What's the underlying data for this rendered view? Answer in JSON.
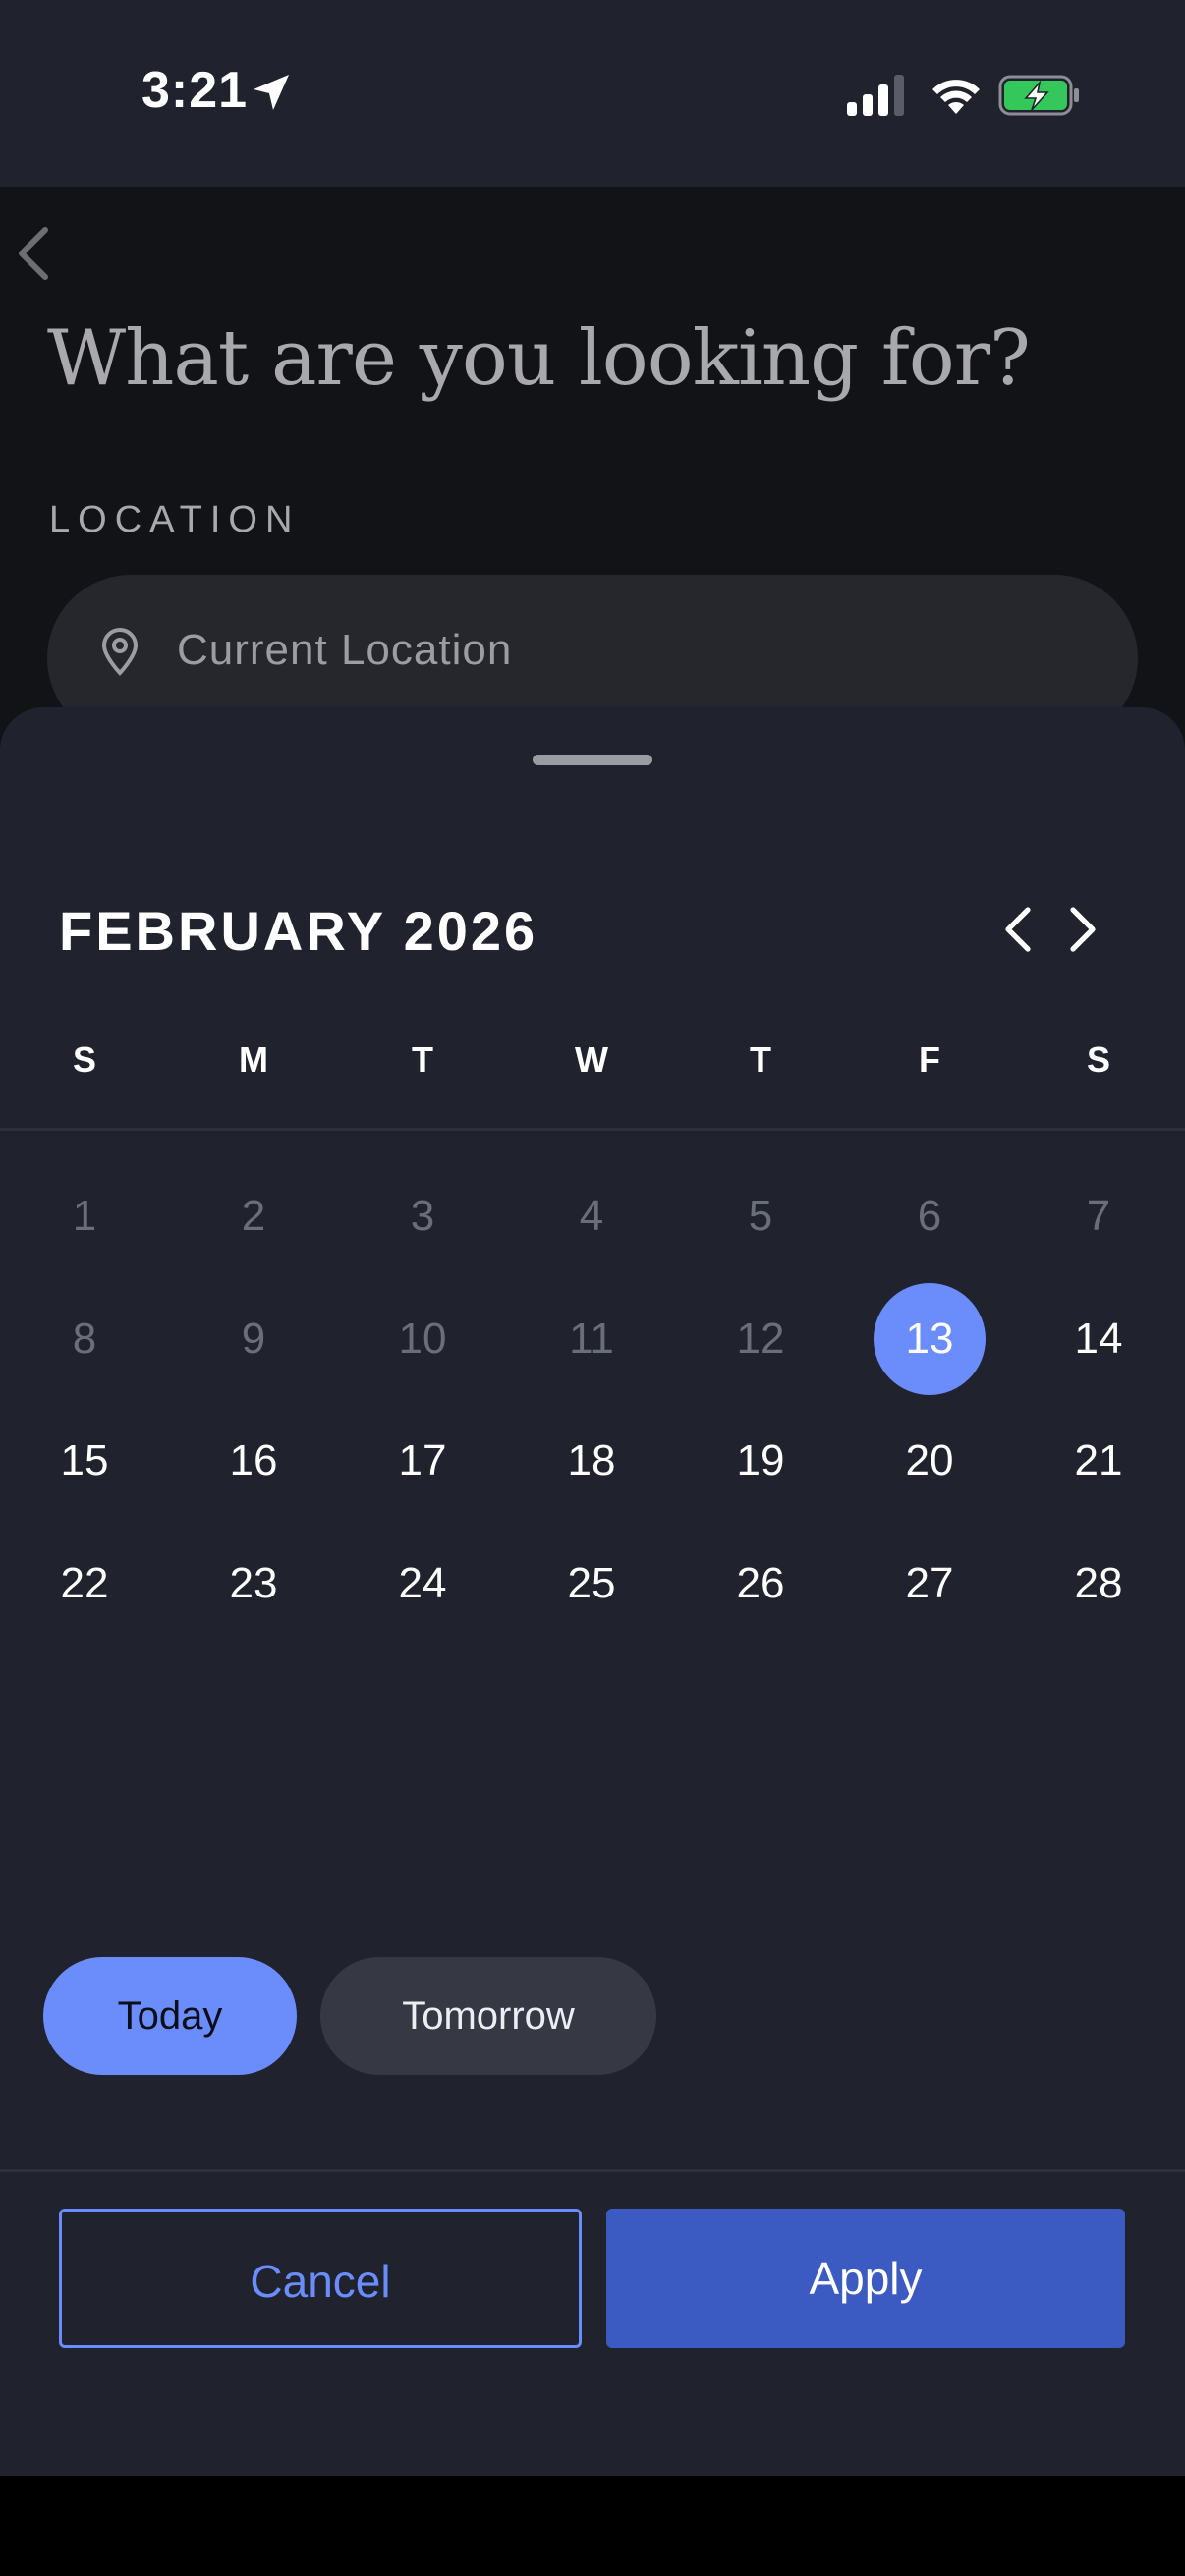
{
  "status_bar": {
    "time": "3:21",
    "icons": [
      "location-arrow-icon",
      "cellular-signal-icon",
      "wifi-icon",
      "battery-charging-icon"
    ],
    "battery_color": "#34c759"
  },
  "page": {
    "back_icon": "chevron-left-icon",
    "headline": "What are you looking for?",
    "location_label": "LOCATION",
    "location_icon": "map-pin-icon",
    "location_value": "Current Location"
  },
  "calendar": {
    "month_title": "FEBRUARY 2026",
    "prev_icon": "chevron-left-icon",
    "next_icon": "chevron-right-icon",
    "weekdays": [
      "S",
      "M",
      "T",
      "W",
      "T",
      "F",
      "S"
    ],
    "weeks": [
      [
        "1",
        "2",
        "3",
        "4",
        "5",
        "6",
        "7"
      ],
      [
        "8",
        "9",
        "10",
        "11",
        "12",
        "13",
        "14"
      ],
      [
        "15",
        "16",
        "17",
        "18",
        "19",
        "20",
        "21"
      ],
      [
        "22",
        "23",
        "24",
        "25",
        "26",
        "27",
        "28"
      ]
    ],
    "selected_day": "13",
    "past_days": [
      "1",
      "2",
      "3",
      "4",
      "5",
      "6",
      "7",
      "8",
      "9",
      "10",
      "11",
      "12"
    ]
  },
  "quick_picks": {
    "today": "Today",
    "tomorrow": "Tomorrow"
  },
  "actions": {
    "cancel": "Cancel",
    "apply": "Apply"
  },
  "colors": {
    "accent": "#6b8dfb",
    "apply_bg": "#3b5ac2",
    "sheet_bg": "#20232d"
  }
}
